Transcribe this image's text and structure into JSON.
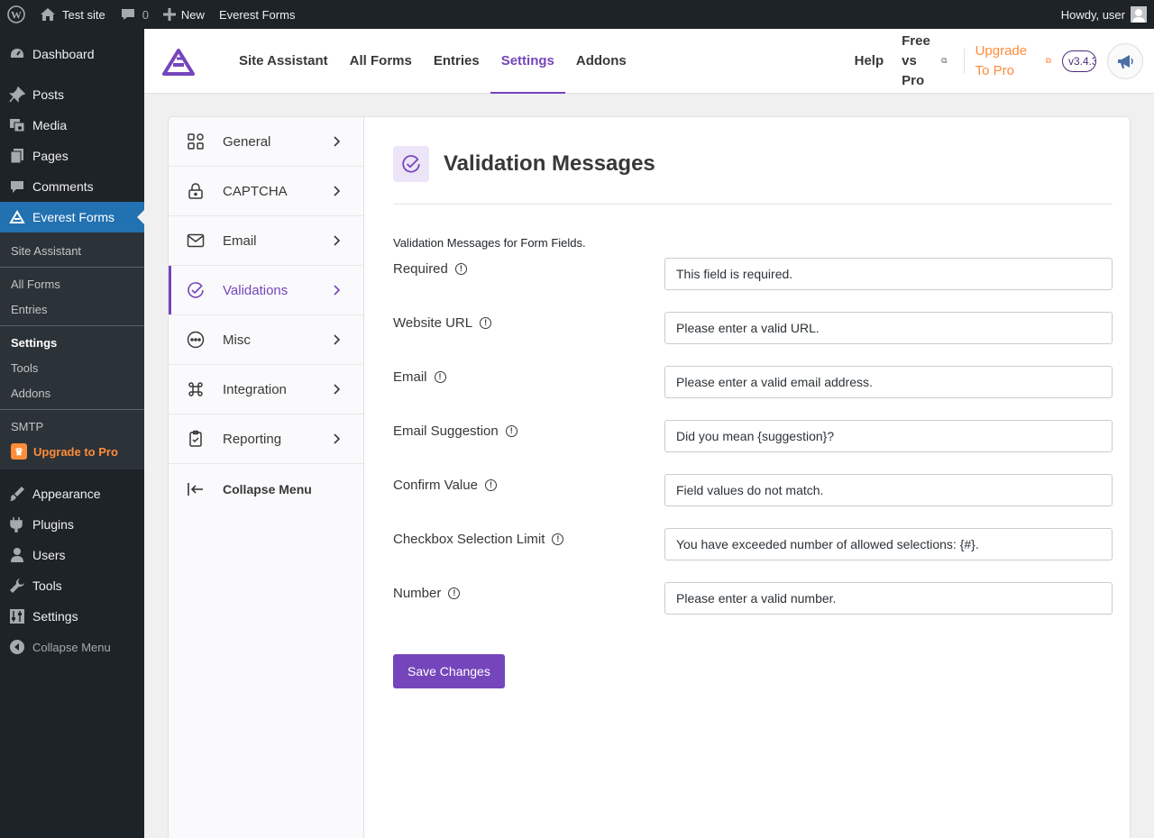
{
  "adminbar": {
    "site_name": "Test site",
    "comments_count": "0",
    "new_label": "New",
    "plugin_link": "Everest Forms",
    "greeting": "Howdy, user"
  },
  "adminmenu": {
    "items": [
      {
        "label": "Dashboard",
        "icon": "dashboard-icon"
      },
      {
        "label": "Posts",
        "icon": "pin-icon"
      },
      {
        "label": "Media",
        "icon": "media-icon"
      },
      {
        "label": "Pages",
        "icon": "pages-icon"
      },
      {
        "label": "Comments",
        "icon": "comments-icon"
      },
      {
        "label": "Everest Forms",
        "icon": "everest-forms-icon"
      },
      {
        "label": "Appearance",
        "icon": "brush-icon"
      },
      {
        "label": "Plugins",
        "icon": "plugin-icon"
      },
      {
        "label": "Users",
        "icon": "users-icon"
      },
      {
        "label": "Tools",
        "icon": "wrench-icon"
      },
      {
        "label": "Settings",
        "icon": "settings-icon"
      },
      {
        "label": "Collapse Menu",
        "icon": "collapse-icon"
      }
    ],
    "submenu": [
      "Site Assistant",
      "All Forms",
      "Entries",
      "Settings",
      "Tools",
      "Addons",
      "SMTP",
      "Upgrade to Pro"
    ]
  },
  "header": {
    "nav": [
      "Site Assistant",
      "All Forms",
      "Entries",
      "Settings",
      "Addons"
    ],
    "help": "Help",
    "free_vs_pro": "Free vs Pro",
    "upgrade": "Upgrade To Pro",
    "version": "v3.4.3",
    "brand_color": "#7545bb",
    "accent_color": "#ff8c39"
  },
  "settings_nav": [
    {
      "label": "General",
      "icon": "grid-icon"
    },
    {
      "label": "CAPTCHA",
      "icon": "lock-icon"
    },
    {
      "label": "Email",
      "icon": "mail-icon"
    },
    {
      "label": "Validations",
      "icon": "check-circle-icon"
    },
    {
      "label": "Misc",
      "icon": "dots-circle-icon"
    },
    {
      "label": "Integration",
      "icon": "command-icon"
    },
    {
      "label": "Reporting",
      "icon": "clipboard-icon"
    },
    {
      "label": "Collapse Menu",
      "icon": "collapse-left-icon"
    }
  ],
  "main": {
    "title": "Validation Messages",
    "description": "Validation Messages for Form Fields.",
    "fields": [
      {
        "label": "Required",
        "value": "This field is required."
      },
      {
        "label": "Website URL",
        "value": "Please enter a valid URL."
      },
      {
        "label": "Email",
        "value": "Please enter a valid email address."
      },
      {
        "label": "Email Suggestion",
        "value": "Did you mean {suggestion}?"
      },
      {
        "label": "Confirm Value",
        "value": "Field values do not match."
      },
      {
        "label": "Checkbox Selection Limit",
        "value": "You have exceeded number of allowed selections: {#}."
      },
      {
        "label": "Number",
        "value": "Please enter a valid number."
      }
    ],
    "save_label": "Save Changes"
  }
}
